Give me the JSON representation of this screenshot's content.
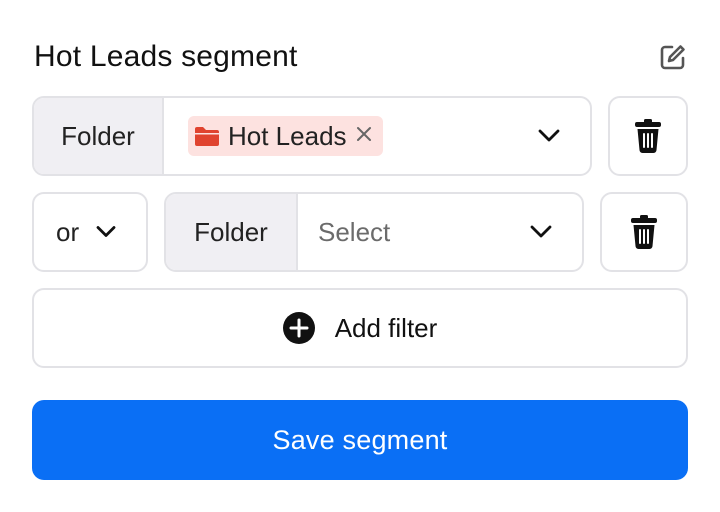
{
  "segment": {
    "title": "Hot Leads segment"
  },
  "filters": [
    {
      "field_label": "Folder",
      "selected_chip": {
        "label": "Hot Leads",
        "icon": "folder-icon",
        "icon_color": "#e0432f",
        "chip_bg": "#fde2e0"
      }
    },
    {
      "connector": "or",
      "field_label": "Folder",
      "placeholder": "Select"
    }
  ],
  "actions": {
    "add_filter_label": "Add filter",
    "save_label": "Save segment"
  },
  "colors": {
    "accent": "#0a6ff5",
    "border": "#e2e2e6",
    "label_bg": "#f0eff3"
  },
  "icons": {
    "edit": "edit-icon",
    "chevron": "chevron-down-icon",
    "trash": "trash-icon",
    "add": "plus-circle-icon",
    "remove": "close-icon"
  }
}
